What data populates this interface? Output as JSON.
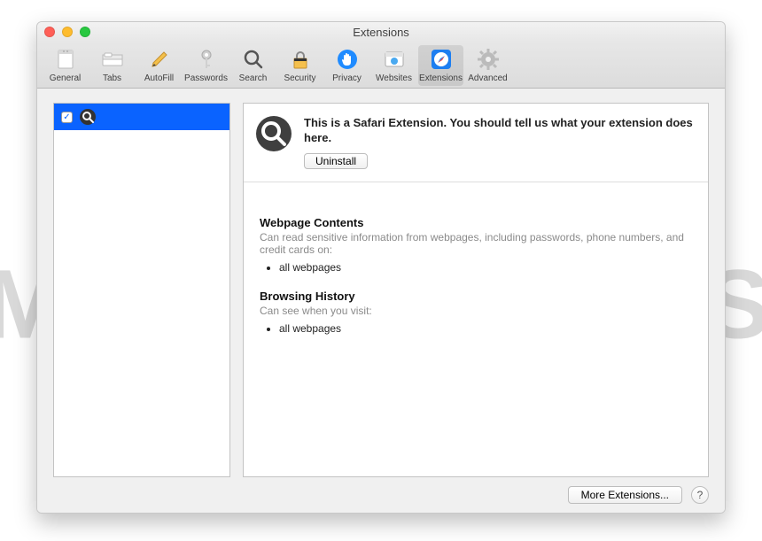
{
  "watermark": "MALWARETIPS",
  "window_title": "Extensions",
  "toolbar": [
    {
      "id": "general",
      "label": "General"
    },
    {
      "id": "tabs",
      "label": "Tabs"
    },
    {
      "id": "autofill",
      "label": "AutoFill"
    },
    {
      "id": "passwords",
      "label": "Passwords"
    },
    {
      "id": "search",
      "label": "Search"
    },
    {
      "id": "security",
      "label": "Security"
    },
    {
      "id": "privacy",
      "label": "Privacy"
    },
    {
      "id": "websites",
      "label": "Websites"
    },
    {
      "id": "extensions",
      "label": "Extensions",
      "active": true
    },
    {
      "id": "advanced",
      "label": "Advanced"
    }
  ],
  "sidebar": {
    "items": [
      {
        "icon": "search",
        "checked": true,
        "selected": true
      }
    ]
  },
  "detail": {
    "description": "This is a Safari Extension. You should tell us what your extension does here.",
    "uninstall_label": "Uninstall",
    "sections": [
      {
        "title": "Webpage Contents",
        "desc": "Can read sensitive information from webpages, including passwords, phone numbers, and credit cards on:",
        "items": [
          "all webpages"
        ]
      },
      {
        "title": "Browsing History",
        "desc": "Can see when you visit:",
        "items": [
          "all webpages"
        ]
      }
    ]
  },
  "footer": {
    "more_label": "More Extensions...",
    "help_label": "?"
  }
}
